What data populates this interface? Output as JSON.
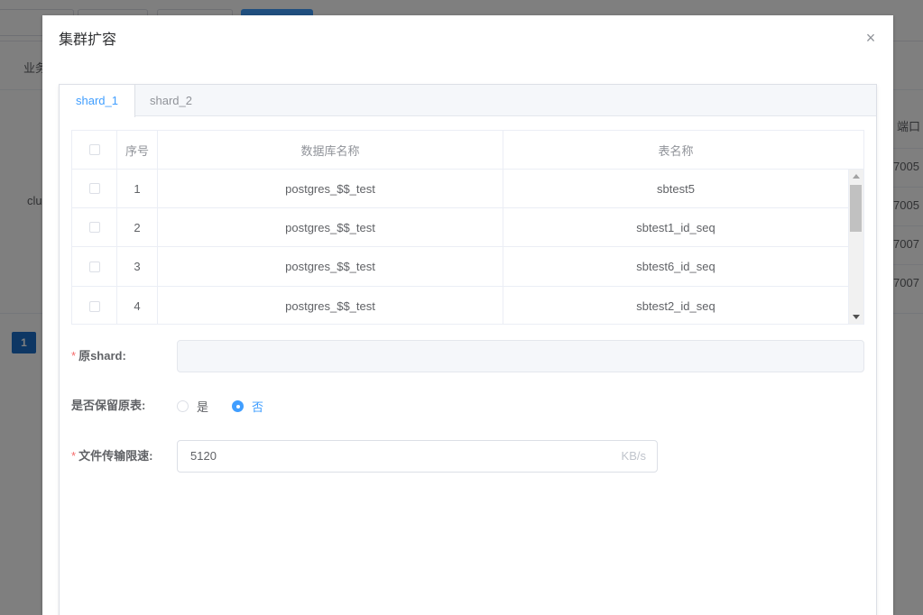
{
  "background": {
    "table_header_partial": "业务",
    "table_header_port": "端口",
    "row_partial": "clus",
    "ports": [
      "7005",
      "7005",
      "7007",
      "7007"
    ],
    "page_number": "1"
  },
  "dialog": {
    "title": "集群扩容",
    "close_icon": "×",
    "tabs": [
      {
        "label": "shard_1",
        "active": true
      },
      {
        "label": "shard_2",
        "active": false
      }
    ],
    "table": {
      "headers": [
        "",
        "序号",
        "数据库名称",
        "表名称"
      ],
      "rows": [
        {
          "index": "1",
          "database": "postgres_$$_test",
          "table": "sbtest5"
        },
        {
          "index": "2",
          "database": "postgres_$$_test",
          "table": "sbtest1_id_seq"
        },
        {
          "index": "3",
          "database": "postgres_$$_test",
          "table": "sbtest6_id_seq"
        },
        {
          "index": "4",
          "database": "postgres_$$_test",
          "table": "sbtest2_id_seq"
        }
      ]
    },
    "form": {
      "source_shard_label": "原shard:",
      "source_shard_value": "",
      "keep_table_label": "是否保留原表:",
      "keep_options": [
        "是",
        "否"
      ],
      "keep_selected": "否",
      "rate_label": "文件传输限速:",
      "rate_value": "5120",
      "rate_unit": "KB/s"
    }
  }
}
